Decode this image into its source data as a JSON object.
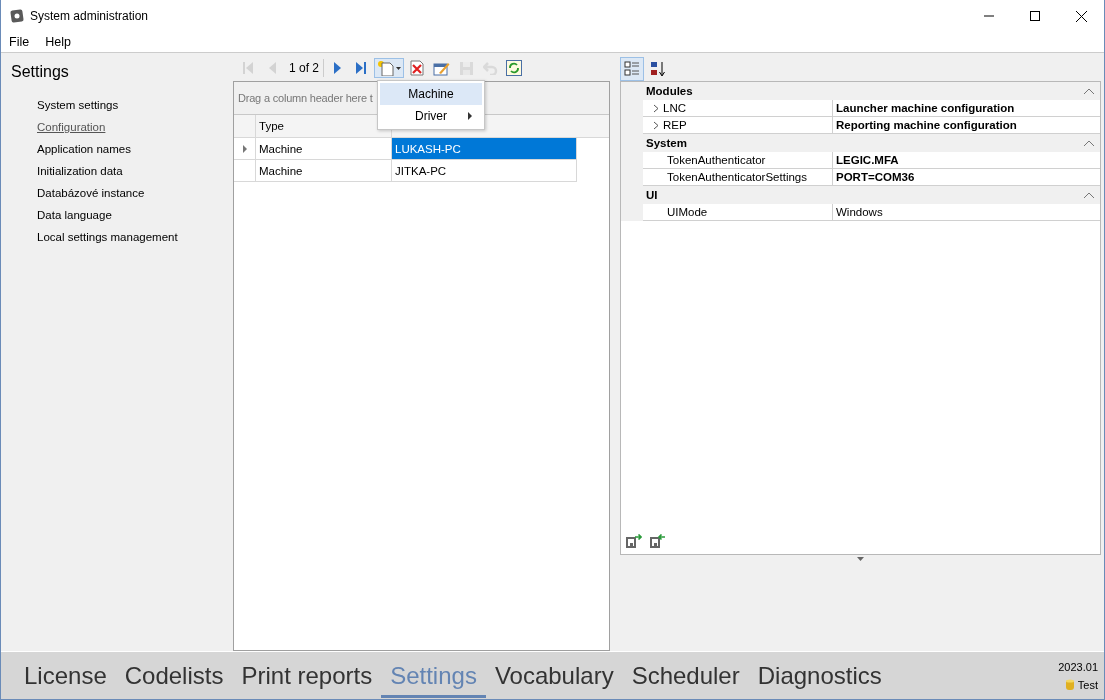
{
  "window": {
    "title": "System administration"
  },
  "menu": [
    "File",
    "Help"
  ],
  "sidebar": {
    "title": "Settings",
    "items": [
      {
        "label": "System settings",
        "selected": false
      },
      {
        "label": "Configuration",
        "selected": true
      },
      {
        "label": "Application names",
        "selected": false
      },
      {
        "label": "Initialization data",
        "selected": false
      },
      {
        "label": "Databázové instance",
        "selected": false
      },
      {
        "label": "Data language",
        "selected": false
      },
      {
        "label": "Local settings management",
        "selected": false
      }
    ]
  },
  "navigator": {
    "position": "1 of 2",
    "buttons": [
      {
        "kind": "first",
        "disabled": true
      },
      {
        "kind": "prev",
        "disabled": true
      },
      {
        "kind": "position"
      },
      {
        "kind": "next",
        "disabled": false
      },
      {
        "kind": "last",
        "disabled": false
      },
      {
        "kind": "new",
        "disabled": false,
        "pressed": true
      },
      {
        "kind": "delete",
        "disabled": false
      },
      {
        "kind": "edit",
        "disabled": false
      },
      {
        "kind": "save",
        "disabled": true
      },
      {
        "kind": "undo",
        "disabled": true
      },
      {
        "kind": "refresh",
        "disabled": false
      }
    ]
  },
  "grid": {
    "group_hint": "Drag a column header here t",
    "columns": [
      "Type"
    ],
    "rows": [
      {
        "type": "Machine",
        "name": "LUKASH-PC",
        "selected": true
      },
      {
        "type": "Machine",
        "name": "JITKA-PC",
        "selected": false
      }
    ]
  },
  "new_menu": {
    "items": [
      {
        "label": "Machine",
        "selected": true,
        "submenu": false
      },
      {
        "label": "Driver",
        "selected": false,
        "submenu": true
      }
    ]
  },
  "property_grid": {
    "view_buttons": [
      {
        "kind": "categorized",
        "selected": true
      },
      {
        "kind": "alphabetical",
        "selected": false
      }
    ],
    "categories": [
      {
        "name": "Modules",
        "expanded": true,
        "rows": [
          {
            "name": "LNC",
            "value": "Launcher machine configuration",
            "bold": true,
            "expandable": true
          },
          {
            "name": "REP",
            "value": "Reporting machine configuration",
            "bold": true,
            "expandable": true
          }
        ]
      },
      {
        "name": "System",
        "expanded": true,
        "rows": [
          {
            "name": "TokenAuthenticator",
            "value": "LEGIC.MFA",
            "bold": true,
            "expandable": false
          },
          {
            "name": "TokenAuthenticatorSettings",
            "value": "PORT=COM36",
            "bold": true,
            "expandable": false
          }
        ]
      },
      {
        "name": "UI",
        "expanded": true,
        "rows": [
          {
            "name": "UIMode",
            "value": "Windows",
            "bold": false,
            "expandable": false
          }
        ]
      }
    ]
  },
  "bottom_tabs": [
    {
      "label": "License",
      "selected": false
    },
    {
      "label": "Codelists",
      "selected": false
    },
    {
      "label": "Print reports",
      "selected": false
    },
    {
      "label": "Settings",
      "selected": true
    },
    {
      "label": "Vocabulary",
      "selected": false
    },
    {
      "label": "Scheduler",
      "selected": false
    },
    {
      "label": "Diagnostics",
      "selected": false
    }
  ],
  "version": "2023.01",
  "environment": "Test"
}
